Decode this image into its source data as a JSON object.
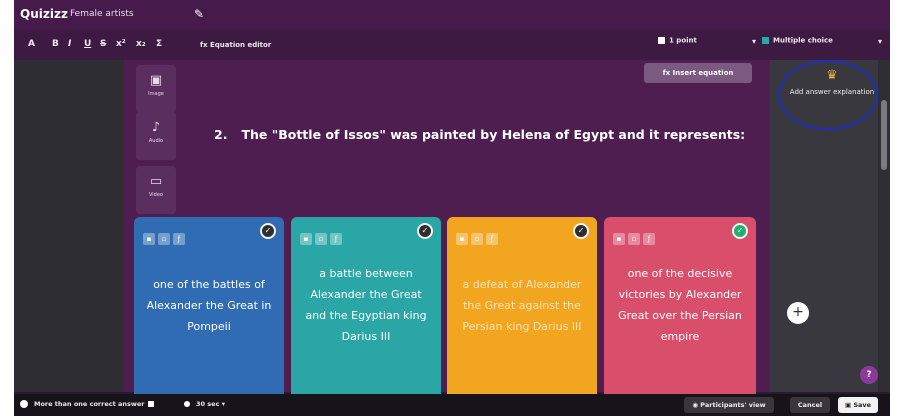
{
  "header": {
    "logo": "Quizizz",
    "quiz_title": "Female artists",
    "edit_icon": "pencil-icon"
  },
  "toolbar": {
    "tools": [
      "A",
      "B",
      "I",
      "U",
      "S",
      "x²",
      "x₂",
      "Σ"
    ],
    "equation_label": "fx Equation editor",
    "time_label": "1 point",
    "question_type": "Multiple choice"
  },
  "left_media": [
    {
      "icon": "image-icon",
      "label": "Image"
    },
    {
      "icon": "mic-icon",
      "label": "Audio"
    },
    {
      "icon": "video-icon",
      "label": "Video"
    }
  ],
  "main": {
    "insert_equation": "fx Insert equation",
    "question_number": "2.",
    "question_text": "The \"Bottle of Issos\" was painted by Helena of Egypt and it represents:"
  },
  "options": [
    {
      "text": "one of the battles of Alexander the Great in Pompeii",
      "color": "#2f6cb3",
      "text_color": "#ffffff",
      "correct": false
    },
    {
      "text": "a battle between Alexander the Great and the Egyptian king Darius III",
      "color": "#2aa6a6",
      "text_color": "#ffffff",
      "correct": false
    },
    {
      "text": "a defeat of Alexander the Great against the Persian king Darius III",
      "color": "#f2a51f",
      "text_color": "#fbe3bb",
      "correct": false
    },
    {
      "text": "one of the decisive victories by Alexander Great over the Persian empire",
      "color": "#d94e6b",
      "text_color": "#ffffff",
      "correct": true
    }
  ],
  "right": {
    "explanation": "Add answer explanation"
  },
  "bottom": {
    "multi_correct": "More than one correct answer",
    "timer": "30 sec",
    "participants_view": "Participants' view",
    "cancel": "Cancel",
    "save": "Save"
  }
}
